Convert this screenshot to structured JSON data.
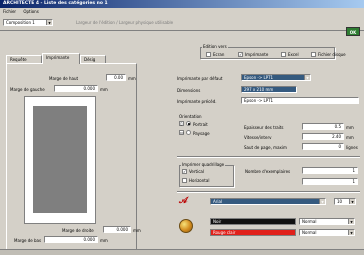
{
  "window": {
    "title": "ARCHITECTE 4 - Liste des catégories no 1"
  },
  "menu": [
    "Fichier",
    "Options"
  ],
  "toolbar": {
    "composition": "Composition 1",
    "width_label": "Largeur de l'édition / Largeur physique utilisable",
    "ok_label": "OK"
  },
  "edition_vers": {
    "title": "Edition vers",
    "options": [
      "Ecran",
      "Imprimante",
      "Excel",
      "Fichier disque"
    ],
    "checked": [
      false,
      true,
      false,
      false
    ]
  },
  "tabs": [
    "Requête",
    "Imprimante",
    "Désig"
  ],
  "active_tab": 1,
  "margins": {
    "top_label": "Marge de haut",
    "top_value": "0.00",
    "left_label": "Marge de gauche",
    "left_value": "0.000",
    "right_label": "Marge de droite",
    "right_value": "0.000",
    "bottom_label": "Marge de bas",
    "bottom_value": "0.000",
    "unit": "mm"
  },
  "printer": {
    "default_label": "Imprimante par défaut",
    "default_value": "Epson -> LPT1",
    "dimensions_label": "Dimensions",
    "dimensions_value": "297 x 210 mm",
    "previous_label": "Imprimante précéd.",
    "previous_value": "Epson -> LPT1"
  },
  "orientation": {
    "title": "Orientation",
    "options": [
      "Portrait",
      "Paysage"
    ],
    "selected": 0
  },
  "line_settings": {
    "thickness_label": "Epaisseur des traits",
    "thickness_value": "0.5",
    "speed_label": "Vitesse/interv",
    "speed_value": "2.40",
    "page_break_label": "Saut de page, maxim",
    "page_break_value": "0",
    "units": [
      "mm",
      "mm",
      "lignes"
    ]
  },
  "quadrillage": {
    "title": "Imprimer quadrillage",
    "options": [
      "Vertical",
      "Horizontal"
    ],
    "checked": [
      true,
      false
    ],
    "copies_label": "Nombre d'exemplaires",
    "copies_value": "1",
    "copies2_value": "1"
  },
  "font": {
    "name": "Arial",
    "size": "10"
  },
  "colors": {
    "row1": {
      "color_name": "Noir",
      "style": "Normal"
    },
    "row2": {
      "color_name": "Rouge clair",
      "style": "Normal"
    },
    "swatch1": "#111111",
    "swatch2": "#e0201a"
  }
}
